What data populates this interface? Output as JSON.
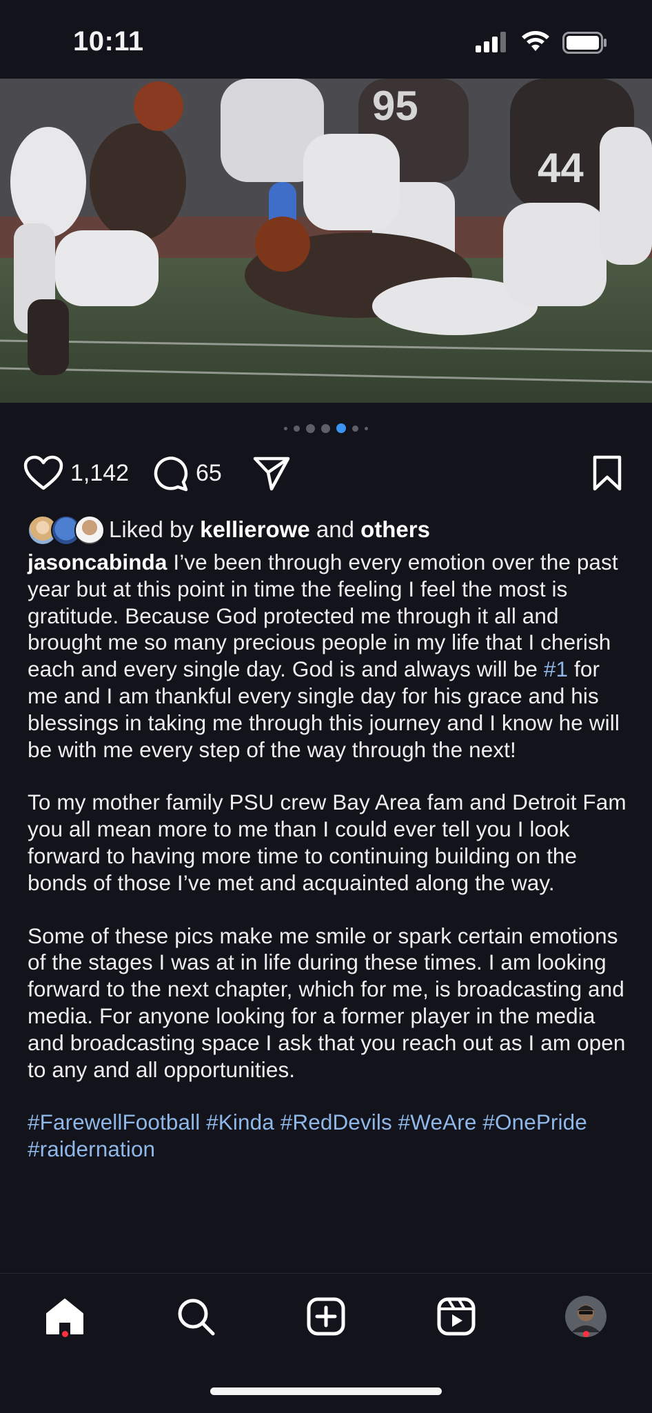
{
  "status_bar": {
    "time": "10:11"
  },
  "post": {
    "carousel": {
      "total": 7,
      "active_index": 4
    },
    "likes_count": "1,142",
    "comments_count": "65",
    "liked_by": {
      "prefix": "Liked by",
      "user": "kellierowe",
      "conj": "and",
      "suffix": "others"
    },
    "caption": {
      "username": "jasoncabinda",
      "p1_before": " I’ve been through every emotion over the past year but at this point in time the feeling I feel the most is gratitude. Because God protected me through it all and brought me so many precious people in my life that I cherish each and every single day. God is and always will be ",
      "p1_tag": "#1",
      "p1_after": " for me and I am thankful every single day for his grace and his blessings in taking me through this journey and I know he will be with me every step of the way through the next!",
      "p2": "To my mother family PSU crew Bay Area fam and Detroit Fam you all mean more to me than I could ever tell you I look forward to having more time to continuing building on the bonds of those I’ve met and acquainted along the way.",
      "p3": "Some of these pics make me smile or spark certain emotions of the stages I was at in life during these times. I am looking forward to the next chapter, which for me, is broadcasting and media. For anyone looking for a former player in the media and broadcasting space I ask that you reach out as I am open to any and all opportunities.",
      "hashtags": [
        "#FarewellFootball",
        "#Kinda",
        "#RedDevils",
        "#WeAre",
        "#OnePride",
        "#raidernation"
      ]
    }
  },
  "nav": [
    "home-icon",
    "search-icon",
    "create-post-icon",
    "reels-icon",
    "profile-avatar"
  ],
  "colors": {
    "background": "#12131b",
    "link": "#8fb7e8",
    "active_dot": "#3b93f2",
    "notification": "#ff3040"
  }
}
